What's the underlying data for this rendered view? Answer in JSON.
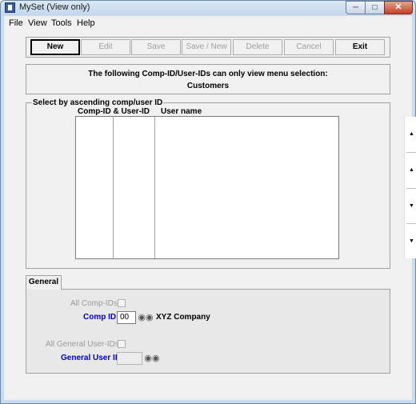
{
  "window": {
    "title": "MySet (View only)",
    "minimize": "─",
    "maximize": "□",
    "close": "✕"
  },
  "menu": {
    "items": [
      {
        "label": "File"
      },
      {
        "label": "View"
      },
      {
        "label": "Tools"
      },
      {
        "label": "Help"
      }
    ]
  },
  "toolbar": {
    "new": "New",
    "edit": "Edit",
    "save": "Save",
    "save_new": "Save / New",
    "delete": "Delete",
    "cancel": "Cancel",
    "exit": "Exit"
  },
  "info": {
    "line1": "The following Comp-ID/User-IDs can only view menu selection:",
    "line2": "Customers"
  },
  "list": {
    "group_title": "Select by ascending comp/user ID",
    "columns": [
      "Comp-ID & User-ID",
      "User name"
    ],
    "rows": []
  },
  "tabs": {
    "general": "General"
  },
  "form": {
    "all_comp_ids_label": "All Comp-IDs",
    "comp_id_label": "Comp ID",
    "comp_id_value": "00",
    "company_name": "XYZ Company",
    "all_general_user_ids_label": "All General User-IDs",
    "general_user_id_label": "General User ID",
    "general_user_id_value": ""
  },
  "colors": {
    "label_blue": "#0000cc",
    "disabled_text": "#9a9a9a"
  },
  "icons": {
    "lookup": "binoculars-icon"
  }
}
